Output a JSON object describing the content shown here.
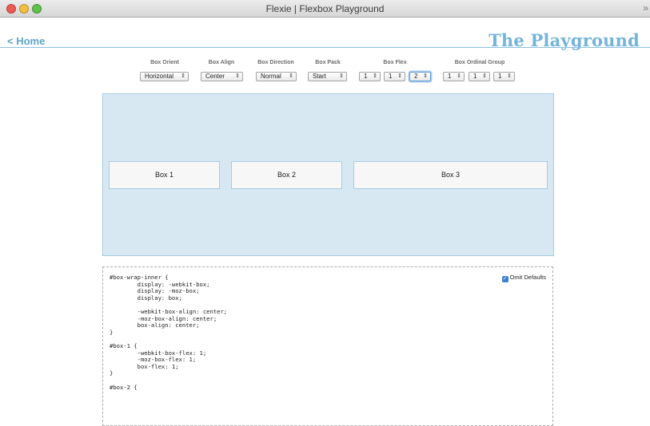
{
  "window": {
    "title": "Flexie | Flexbox Playground",
    "right_glyph": "»"
  },
  "header": {
    "home_link": "< Home",
    "brand": "The Playground"
  },
  "controls": {
    "box_orient": {
      "label": "Box Orient",
      "value": "Horizontal"
    },
    "box_align": {
      "label": "Box Align",
      "value": "Center"
    },
    "box_direction": {
      "label": "Box Direction",
      "value": "Normal"
    },
    "box_pack": {
      "label": "Box Pack",
      "value": "Start"
    },
    "box_flex": {
      "label": "Box Flex",
      "values": [
        "1",
        "1",
        "2"
      ]
    },
    "box_ordinal_group": {
      "label": "Box Ordinal Group",
      "values": [
        "1",
        "1",
        "1"
      ]
    },
    "arrow": "⇕"
  },
  "stage": {
    "boxes": [
      "Box 1",
      "Box 2",
      "Box 3"
    ]
  },
  "code": {
    "omit_defaults": "Omit Defaults",
    "checked_mark": "✓",
    "text": "#box-wrap-inner {\n        display: -webkit-box;\n        display: -moz-box;\n        display: box;\n\n        -webkit-box-align: center;\n        -moz-box-align: center;\n        box-align: center;\n}\n\n#box-1 {\n        -webkit-box-flex: 1;\n        -moz-box-flex: 1;\n        box-flex: 1;\n}\n\n#box-2 {"
  },
  "colors": {
    "accent": "#74b4da",
    "stage_bg": "#d7e8f3",
    "link": "#5fa3c9"
  }
}
